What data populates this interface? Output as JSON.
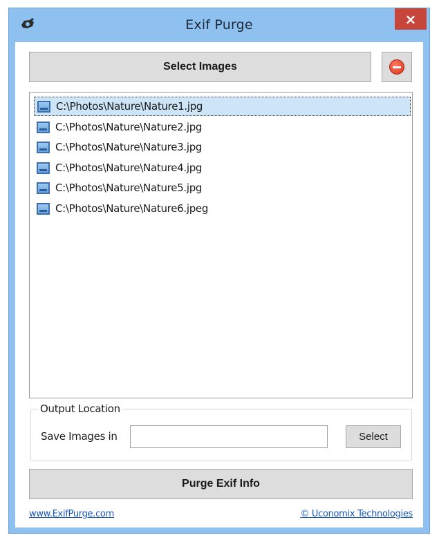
{
  "window": {
    "title": "Exif Purge",
    "close_label": "×"
  },
  "toolbar": {
    "select_images_label": "Select Images"
  },
  "file_list": [
    "C:\\Photos\\Nature\\Nature1.jpg",
    "C:\\Photos\\Nature\\Nature2.jpg",
    "C:\\Photos\\Nature\\Nature3.jpg",
    "C:\\Photos\\Nature\\Nature4.jpg",
    "C:\\Photos\\Nature\\Nature5.jpg",
    "C:\\Photos\\Nature\\Nature6.jpeg"
  ],
  "selected_index": 0,
  "output": {
    "legend": "Output Location",
    "save_label": "Save Images in",
    "save_value": "",
    "select_label": "Select"
  },
  "purge_label": "Purge Exif Info",
  "footer": {
    "website": "www.ExifPurge.com",
    "copyright": "© Uconomix Technologies"
  },
  "colors": {
    "title_bar": "#8ec1f0",
    "close_button": "#c7463c",
    "selection": "#cde5f7",
    "link": "#1a56b8"
  },
  "icons": {
    "app": "app-logo-icon",
    "remove": "remove-icon",
    "file": "image-file-icon"
  }
}
